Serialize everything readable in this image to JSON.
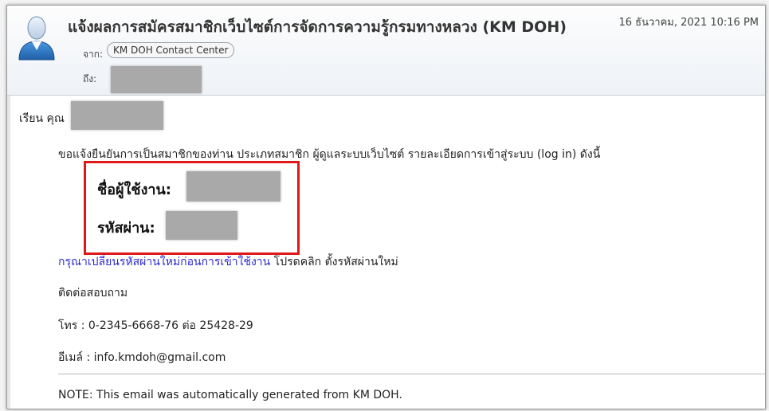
{
  "header": {
    "subject": "แจ้งผลการสมัครสมาชิกเว็บไซต์การจัดการความรู้กรมทางหลวง (KM DOH)",
    "date": "16 ธันวาคม, 2021 10:16 PM",
    "from_label": "จาก:",
    "from_name": "KM DOH Contact Center",
    "to_label": "ถึง:",
    "avatar_icon": "user-avatar-icon"
  },
  "body": {
    "greeting": "เรียน คุณ",
    "confirm_text": "ขอแจ้งยืนยันการเป็นสมาชิกของท่าน ประเภทสมาชิก ผู้ดูแลระบบเว็บไซต์ รายละเอียดการเข้าสู่ระบบ (log in) ดังนี้",
    "username_label": "ชื่อผู้ใช้งาน:",
    "password_label": "รหัสผ่าน:",
    "change_link": "กรุณาเปลี่ยนรหัสผ่านใหม่ก่อนการเข้าใช้งาน",
    "change_rest": " โปรดคลิก ตั้งรหัสผ่านใหม่",
    "contact": "ติดต่อสอบถาม",
    "phone": "โทร : 0-2345-6668-76 ต่อ 25428-29",
    "email": "อีเมล์ : info.kmdoh@gmail.com",
    "note": "NOTE: This email was automatically generated from KM DOH."
  },
  "colors": {
    "highlight_border": "#e01818",
    "link": "#2a2ad0",
    "redaction": "#a9a9a9"
  }
}
